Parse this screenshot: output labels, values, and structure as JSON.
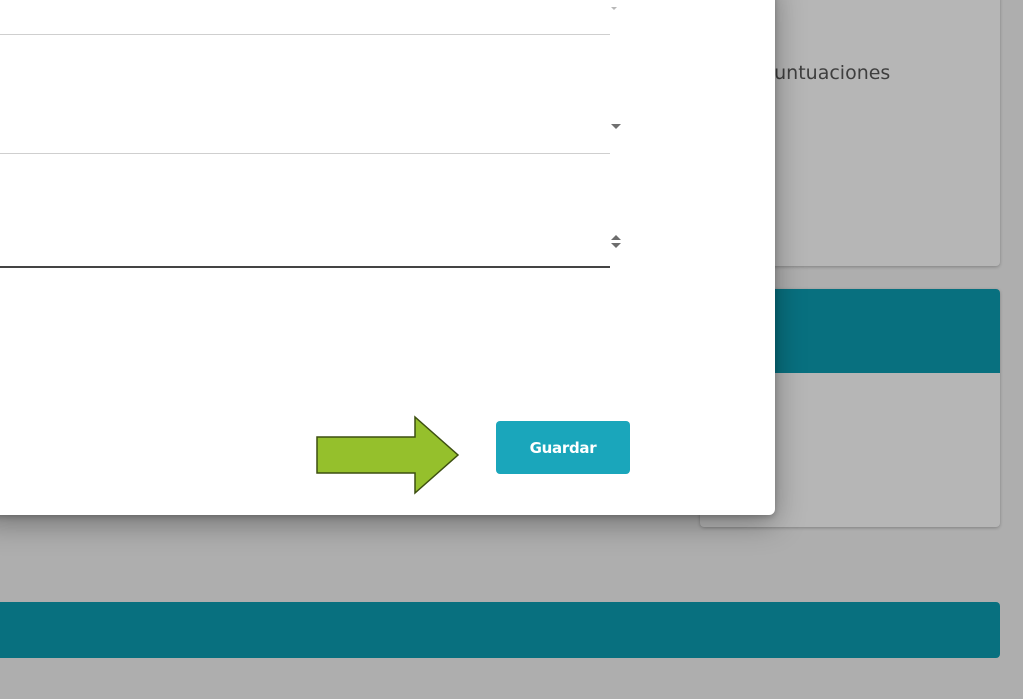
{
  "background": {
    "card_text": "Puntuaciones",
    "colors": {
      "overlay_gray": "#aeaeae",
      "card_gray": "#b6b6b6",
      "teal_bar": "#08707f"
    }
  },
  "dialog": {
    "save_button_label": "Guardar",
    "save_button_color": "#1aa6bb",
    "icons": {
      "select_arrow": "caret-down-icon",
      "number_spinner": "spinner-updown-icon",
      "annotation_arrow": "arrow-right-icon"
    },
    "annotation_arrow_color": "#95c02c"
  }
}
